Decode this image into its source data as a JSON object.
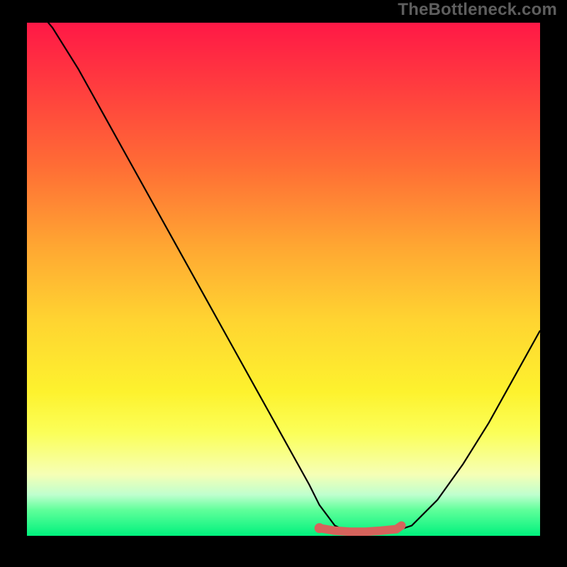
{
  "watermark": "TheBottleneck.com",
  "colors": {
    "frame_bg": "#000000",
    "curve_stroke": "#000000",
    "marker_fill": "#d6635c",
    "gradient_top": "#ff1846",
    "gradient_bottom": "#00f17d"
  },
  "chart_data": {
    "type": "line",
    "title": "",
    "xlabel": "",
    "ylabel": "",
    "xlim": [
      0,
      100
    ],
    "ylim": [
      0,
      100
    ],
    "grid": false,
    "series": [
      {
        "name": "curve",
        "x": [
          0,
          5,
          10,
          15,
          20,
          25,
          30,
          35,
          40,
          45,
          50,
          55,
          57,
          60,
          62,
          65,
          68,
          72,
          75,
          80,
          85,
          90,
          95,
          100
        ],
        "y": [
          105,
          99,
          91,
          82,
          73,
          64,
          55,
          46,
          37,
          28,
          19,
          10,
          6,
          2,
          1,
          0.5,
          0.5,
          1,
          2,
          7,
          14,
          22,
          31,
          40
        ]
      },
      {
        "name": "optimal-range",
        "x": [
          57,
          60,
          63,
          66,
          69,
          72,
          73
        ],
        "y": [
          1.5,
          1,
          0.8,
          0.8,
          1,
          1.3,
          2
        ]
      }
    ],
    "annotations": {
      "optimal_point": {
        "x": 57,
        "y": 1.5
      }
    }
  }
}
